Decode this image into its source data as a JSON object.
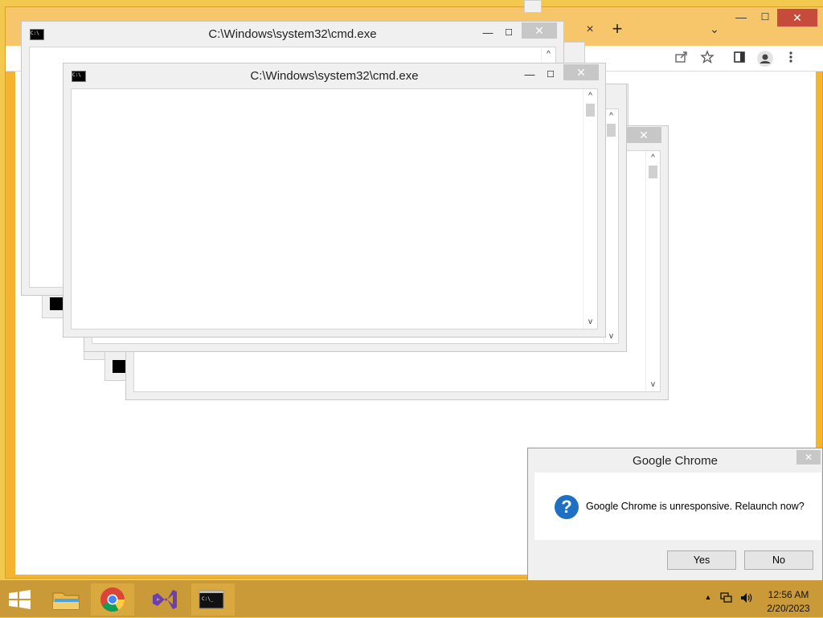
{
  "chrome": {
    "new_tab_symbol": "+",
    "tab_close_symbol": "×",
    "tab_search_symbol": "⌄",
    "minimize_symbol": "—",
    "maximize_symbol": "☐",
    "close_symbol": "✕",
    "toolbar_icons": [
      "share-icon",
      "star-icon",
      "sidepanel-icon",
      "profile-icon",
      "menu-icon"
    ]
  },
  "cmd_windows": {
    "title": "C:\\Windows\\system32\\cmd.exe",
    "minimize_symbol": "—",
    "maximize_symbol": "☐",
    "close_symbol": "✕",
    "scroll_up_symbol": "^",
    "scroll_down_symbol": "v"
  },
  "dialog": {
    "title": "Google Chrome",
    "close_symbol": "✕",
    "icon_glyph": "?",
    "message": "Google Chrome is unresponsive. Relaunch now?",
    "yes_label": "Yes",
    "no_label": "No"
  },
  "taskbar": {
    "apps": [
      "start-button",
      "file-explorer",
      "google-chrome",
      "visual-studio",
      "command-prompt"
    ],
    "tray_up_symbol": "▲",
    "time": "12:56 AM",
    "date": "2/20/2023"
  },
  "colors": {
    "accent_yellow": "#f2c94c",
    "taskbar": "#c99a37",
    "close_red": "#c74b3b",
    "dialog_icon_blue": "#1f6fc2"
  }
}
